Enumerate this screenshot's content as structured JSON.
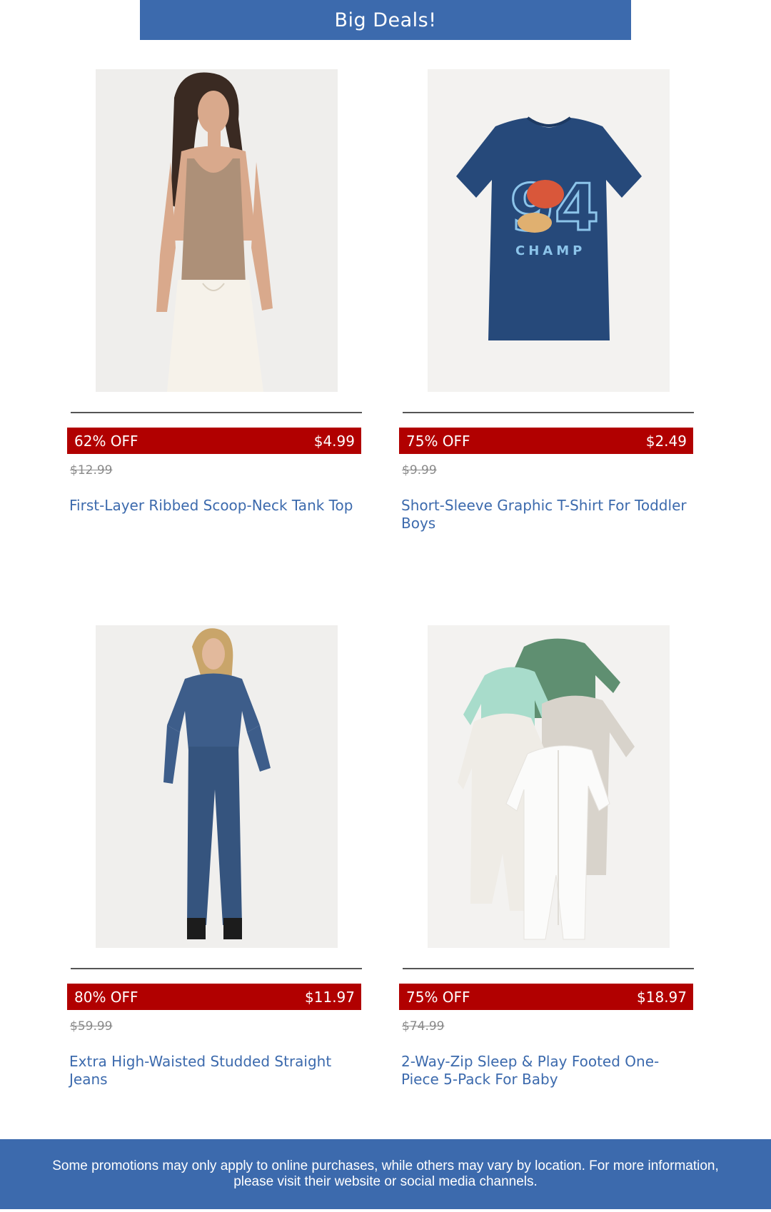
{
  "header": {
    "title": "Big Deals!"
  },
  "products": [
    {
      "name": "First-Layer Ribbed Scoop-Neck Tank Top",
      "discount": "62% OFF",
      "price": "$4.99",
      "original_price": "$12.99",
      "image_icon": "woman-tank-top-photo"
    },
    {
      "name": "Short-Sleeve Graphic T-Shirt For Toddler Boys",
      "discount": "75% OFF",
      "price": "$2.49",
      "original_price": "$9.99",
      "image_icon": "graphic-tshirt-photo"
    },
    {
      "name": "Extra High-Waisted Studded Straight Jeans",
      "discount": "80% OFF",
      "price": "$11.97",
      "original_price": "$59.99",
      "image_icon": "woman-denim-outfit-photo"
    },
    {
      "name": "2-Way-Zip Sleep & Play Footed One-Piece 5-Pack For Baby",
      "discount": "75% OFF",
      "price": "$18.97",
      "original_price": "$74.99",
      "image_icon": "baby-onesie-pack-photo"
    }
  ],
  "shirt_graphic": {
    "number": "94",
    "word": "CHAMP"
  },
  "footer": {
    "disclaimer": "Some promotions may only apply to online purchases, while others may vary by location. For more information, please visit their website or social media channels."
  },
  "colors": {
    "brand_blue": "#3c6aad",
    "deal_red": "#b10000",
    "text_gray": "#8a8a8a"
  }
}
